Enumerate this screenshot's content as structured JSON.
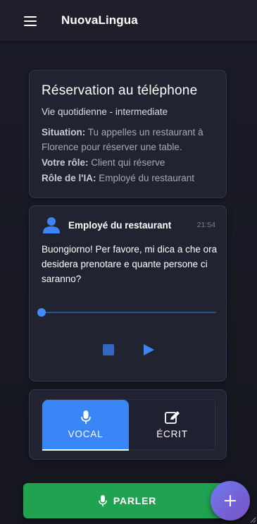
{
  "app": {
    "title": "NuovaLingua"
  },
  "scenario": {
    "title": "Réservation au téléphone",
    "subtitle": "Vie quotidienne - intermediate",
    "situation_label": "Situation:",
    "situation_text": "Tu appelles un restaurant à Florence pour réserver une table.",
    "role_label": "Votre rôle:",
    "role_text": "Client qui réserve",
    "ai_role_label": "Rôle de l'IA:",
    "ai_role_text": "Employé du restaurant"
  },
  "message": {
    "sender": "Employé du restaurant",
    "time": "21:54",
    "text": "Buongiorno! Per favore, mi dica a che ora desidera prenotare e quante persone ci saranno?",
    "audio_progress": 0
  },
  "mode": {
    "selected": "vocal",
    "options": [
      {
        "id": "vocal",
        "label": "VOCAL",
        "icon": "microphone-icon"
      },
      {
        "id": "ecrit",
        "label": "ÉCRIT",
        "icon": "edit-icon"
      }
    ]
  },
  "actions": {
    "speak_label": "PARLER",
    "fab_icon": "plus-icon"
  },
  "colors": {
    "background": "#1b1c28",
    "card": "#222331",
    "accent_blue": "#3b86f6",
    "speak_green": "#20a350",
    "fab_gradient_start": "#6f7bf0",
    "fab_gradient_end": "#7a4fc4"
  }
}
